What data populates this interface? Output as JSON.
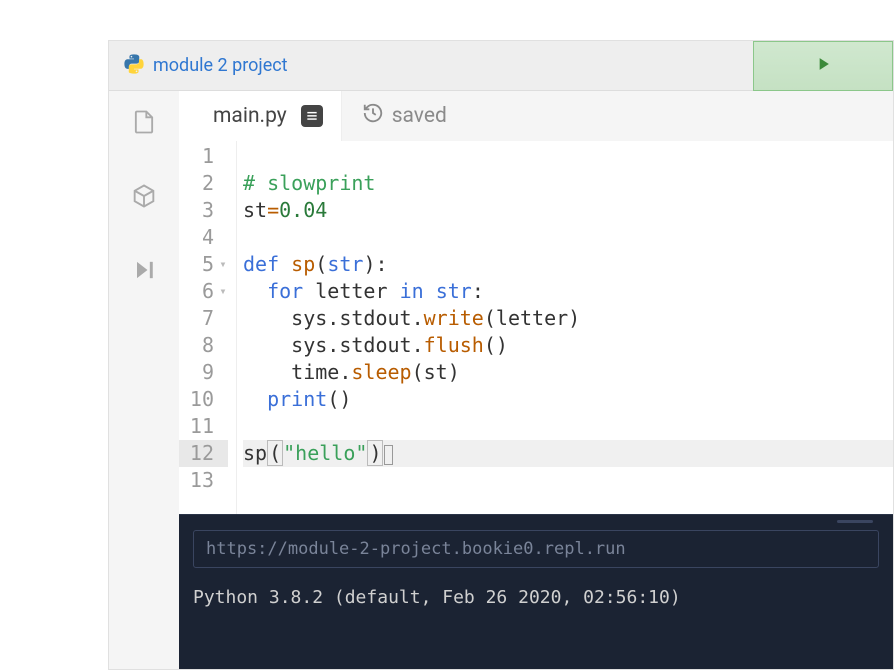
{
  "header": {
    "project_name": "module 2 project"
  },
  "tabs": {
    "active_file": "main.py",
    "saved_label": "saved"
  },
  "code": {
    "lines": [
      {
        "n": "1",
        "fold": "",
        "segments": []
      },
      {
        "n": "2",
        "fold": "",
        "segments": [
          {
            "t": "# slowprint",
            "c": "k-comment"
          }
        ]
      },
      {
        "n": "3",
        "fold": "",
        "segments": [
          {
            "t": "st",
            "c": "k-var"
          },
          {
            "t": "=",
            "c": "k-op"
          },
          {
            "t": "0.04",
            "c": "k-num"
          }
        ]
      },
      {
        "n": "4",
        "fold": "",
        "segments": []
      },
      {
        "n": "5",
        "fold": "▾",
        "segments": [
          {
            "t": "def ",
            "c": "k-def"
          },
          {
            "t": "sp",
            "c": "k-method"
          },
          {
            "t": "(",
            "c": "k-paren"
          },
          {
            "t": "str",
            "c": "k-builtin"
          },
          {
            "t": "):",
            "c": "k-paren"
          }
        ]
      },
      {
        "n": "6",
        "fold": "▾",
        "segments": [
          {
            "t": "  ",
            "c": ""
          },
          {
            "t": "for ",
            "c": "k-kw"
          },
          {
            "t": "letter ",
            "c": "k-var"
          },
          {
            "t": "in ",
            "c": "k-kw"
          },
          {
            "t": "str",
            "c": "k-builtin"
          },
          {
            "t": ":",
            "c": "k-paren"
          }
        ]
      },
      {
        "n": "7",
        "fold": "",
        "segments": [
          {
            "t": "    sys",
            "c": "k-var"
          },
          {
            "t": ".",
            "c": "k-paren"
          },
          {
            "t": "stdout",
            "c": "k-var"
          },
          {
            "t": ".",
            "c": "k-paren"
          },
          {
            "t": "write",
            "c": "k-method"
          },
          {
            "t": "(letter)",
            "c": "k-paren"
          }
        ]
      },
      {
        "n": "8",
        "fold": "",
        "segments": [
          {
            "t": "    sys",
            "c": "k-var"
          },
          {
            "t": ".",
            "c": "k-paren"
          },
          {
            "t": "stdout",
            "c": "k-var"
          },
          {
            "t": ".",
            "c": "k-paren"
          },
          {
            "t": "flush",
            "c": "k-method"
          },
          {
            "t": "()",
            "c": "k-paren"
          }
        ]
      },
      {
        "n": "9",
        "fold": "",
        "segments": [
          {
            "t": "    time",
            "c": "k-var"
          },
          {
            "t": ".",
            "c": "k-paren"
          },
          {
            "t": "sleep",
            "c": "k-method"
          },
          {
            "t": "(st)",
            "c": "k-paren"
          }
        ]
      },
      {
        "n": "10",
        "fold": "",
        "segments": [
          {
            "t": "  ",
            "c": ""
          },
          {
            "t": "print",
            "c": "k-builtin"
          },
          {
            "t": "()",
            "c": "k-paren"
          }
        ]
      },
      {
        "n": "11",
        "fold": "",
        "segments": []
      },
      {
        "n": "12",
        "fold": "",
        "active": true,
        "segments": [
          {
            "t": "sp",
            "c": "k-var"
          },
          {
            "t": "(",
            "c": "k-paren bracket-hl"
          },
          {
            "t": "\"hello\"",
            "c": "k-string"
          },
          {
            "t": ")",
            "c": "k-paren bracket-hl"
          }
        ],
        "cursor": true
      },
      {
        "n": "13",
        "fold": "",
        "segments": []
      }
    ]
  },
  "terminal": {
    "url": "https://module-2-project.bookie0.repl.run",
    "line1": "Python 3.8.2 (default, Feb 26 2020, 02:56:10)",
    "prompt": "  "
  }
}
